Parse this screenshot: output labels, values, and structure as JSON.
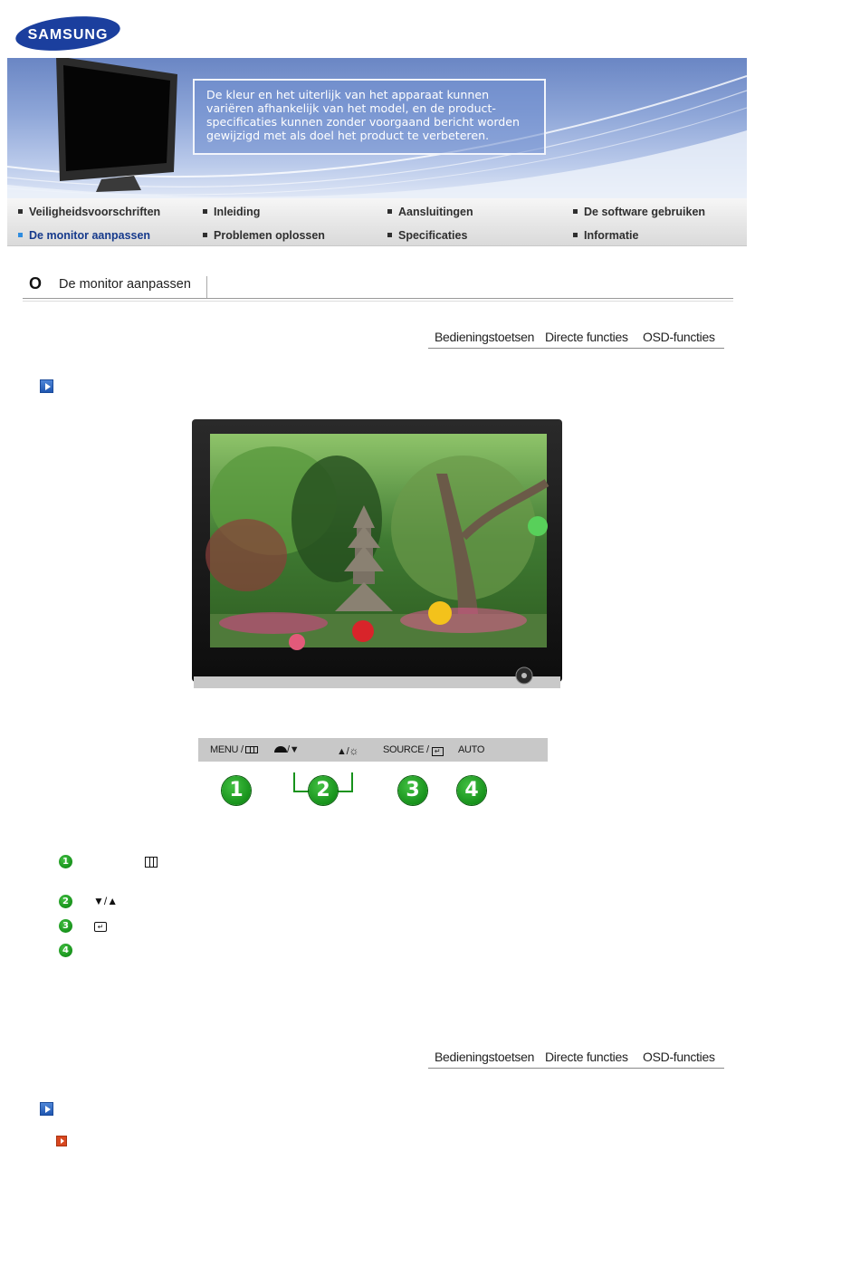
{
  "header": {
    "logo_text": "SAMSUNG"
  },
  "banner": {
    "notice_lines": [
      "De kleur en het uiterlijk van het apparaat kunnen",
      "variëren afhankelijk van het model, en de product-",
      "specificaties kunnen zonder voorgaand bericht worden",
      "gewijzigd met als doel het product te verbeteren."
    ]
  },
  "nav": {
    "items": [
      {
        "label": "Veiligheidsvoorschriften"
      },
      {
        "label": "Inleiding"
      },
      {
        "label": "Aansluitingen"
      },
      {
        "label": "De software gebruiken"
      },
      {
        "label": "De monitor aanpassen"
      },
      {
        "label": "Problemen oplossen"
      },
      {
        "label": "Specificaties"
      },
      {
        "label": "Informatie"
      }
    ],
    "active": "De monitor aanpassen"
  },
  "page": {
    "title_marker": "O",
    "title": "De monitor aanpassen"
  },
  "tabs": [
    {
      "label": "Bedieningstoetsen"
    },
    {
      "label": "Directe functies"
    },
    {
      "label": "OSD-functies"
    }
  ],
  "control_bar": {
    "menu": "MENU / ",
    "down": "/▼",
    "up": "▲/",
    "source": "SOURCE / ",
    "auto": "AUTO"
  },
  "callouts": [
    "1",
    "2",
    "3",
    "4"
  ],
  "list_glyphs": {
    "row2": "▼/▲"
  },
  "colors": {
    "banner": "#8ea6d8",
    "nav_active": "#163a8c",
    "callout_green": "#17921b",
    "section_icon": "#1f56b0"
  }
}
